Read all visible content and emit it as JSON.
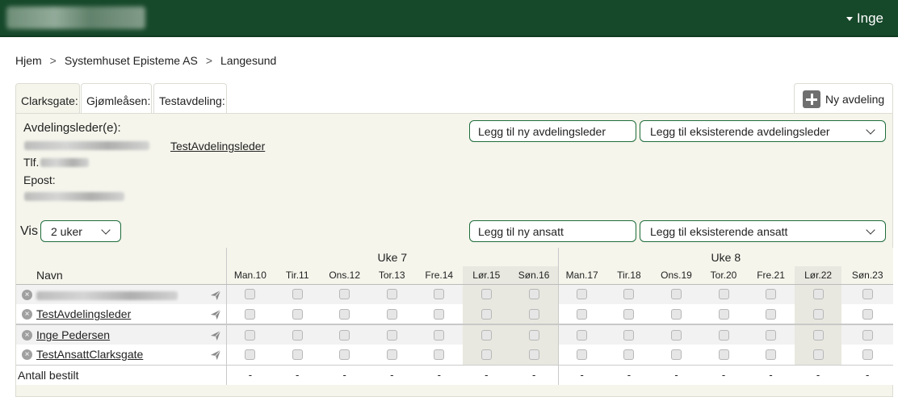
{
  "header": {
    "user_name": "Inge"
  },
  "breadcrumb": [
    "Hjem",
    "Systemhuset Episteme AS",
    "Langesund"
  ],
  "breadcrumb_sep": ">",
  "tabs": [
    {
      "label": "Clarksgate:"
    },
    {
      "label": "Gjømleåsen:"
    },
    {
      "label": "Testavdeling:"
    }
  ],
  "new_dept_label": "Ny avdeling",
  "leaders": {
    "title": "Avdelingsleder(e):",
    "second_leader": "TestAvdelingsleder",
    "phone_label": "Tlf.",
    "email_label": "Epost:",
    "add_new_btn": "Legg til ny avdelingsleder",
    "add_existing_select": "Legg til eksisterende avdelingsleder"
  },
  "view": {
    "label": "Vis",
    "period": "2 uker",
    "add_employee_btn": "Legg til ny ansatt",
    "add_existing_employee_select": "Legg til eksisterende ansatt"
  },
  "schedule": {
    "name_header": "Navn",
    "weeks": [
      {
        "label": "Uke 7",
        "days": [
          "Man.10",
          "Tir.11",
          "Ons.12",
          "Tor.13",
          "Fre.14",
          "Lør.15",
          "Søn.16"
        ]
      },
      {
        "label": "Uke 8",
        "days": [
          "Man.17",
          "Tir.18",
          "Ons.19",
          "Tor.20",
          "Fre.21",
          "Lør.22",
          "Søn.23"
        ]
      }
    ],
    "leader_rows": [
      {
        "name": ""
      },
      {
        "name": "TestAvdelingsleder"
      }
    ],
    "employee_rows": [
      {
        "name": "Inge Pedersen"
      },
      {
        "name": "TestAnsattClarksgate"
      }
    ],
    "total_label": "Antall bestilt",
    "totals": [
      "-",
      "-",
      "-",
      "-",
      "-",
      "-",
      "-",
      "-",
      "-",
      "-",
      "-",
      "-",
      "-",
      "-"
    ]
  },
  "icons": {
    "remove": "remove-circle-icon",
    "send": "send-icon",
    "add": "plus-icon",
    "dropdown": "chevron-down-icon"
  }
}
